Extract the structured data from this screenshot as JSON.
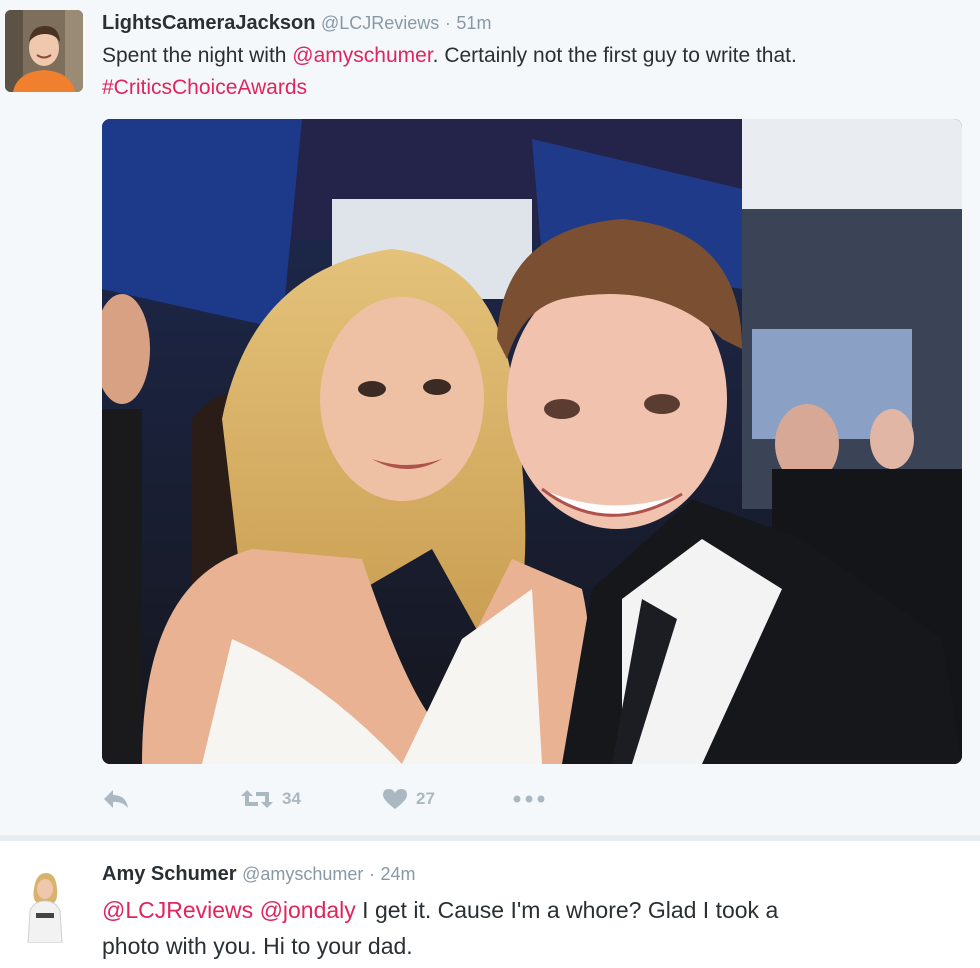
{
  "tweets": [
    {
      "display_name": "LightsCameraJackson",
      "handle": "@LCJReviews",
      "separator": "·",
      "time": "51m",
      "text_before": "Spent the night with ",
      "mention": "@amyschumer",
      "text_after": ". Certainly not the first guy to write that.",
      "hashtag": "#CriticsChoiceAwards",
      "retweets": "34",
      "likes": "27",
      "icons": [
        "reply-icon",
        "retweet-icon",
        "heart-icon",
        "more-icon"
      ]
    },
    {
      "display_name": "Amy Schumer",
      "handle": "@amyschumer",
      "separator": "·",
      "time": "24m",
      "mention1": "@LCJReviews",
      "mention2": "@jondaly",
      "text_line1": " I get it. Cause  I'm a whore? Glad I took a",
      "text_line2": "photo with you. Hi to your dad."
    }
  ],
  "colors": {
    "link": "#e0245e",
    "secondary_text": "#8899a6",
    "icon": "#aab8c2",
    "tweet_bg": "#f5f8fa"
  }
}
